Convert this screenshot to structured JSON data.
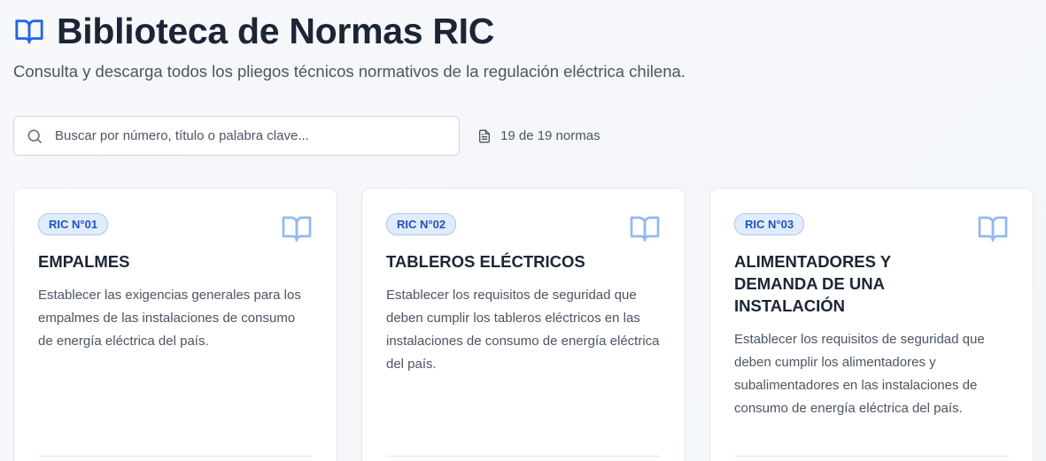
{
  "header": {
    "title": "Biblioteca de Normas RIC",
    "icon": "book-open-icon",
    "subtitle": "Consulta y descarga todos los pliegos técnicos normativos de la regulación eléctrica chilena."
  },
  "search": {
    "placeholder": "Buscar por número, título o palabra clave...",
    "value": "",
    "icon": "search-icon"
  },
  "count": {
    "icon": "document-icon",
    "label": "19 de 19 normas"
  },
  "colors": {
    "accent": "#2563eb",
    "badge_bg": "#e0ecfc",
    "badge_text": "#1e55b8",
    "title": "#1c2535",
    "muted": "#4b5563"
  },
  "cards": [
    {
      "badge": "RIC N°01",
      "title": "EMPALMES",
      "description": "Establecer las exigencias generales para los empalmes de las instalaciones de consumo de energía eléctrica del país.",
      "icon": "book-open-icon"
    },
    {
      "badge": "RIC N°02",
      "title": "TABLEROS ELÉCTRICOS",
      "description": "Establecer los requisitos de seguridad que deben cumplir los tableros eléctricos en las instalaciones de consumo de energía eléctrica del país.",
      "icon": "book-open-icon"
    },
    {
      "badge": "RIC N°03",
      "title": "ALIMENTADORES Y DEMANDA DE UNA INSTALACIÓN",
      "description": "Establecer los requisitos de seguridad que deben cumplir los alimentadores y subalimentadores en las instalaciones de consumo de energía eléctrica del país.",
      "icon": "book-open-icon"
    }
  ]
}
